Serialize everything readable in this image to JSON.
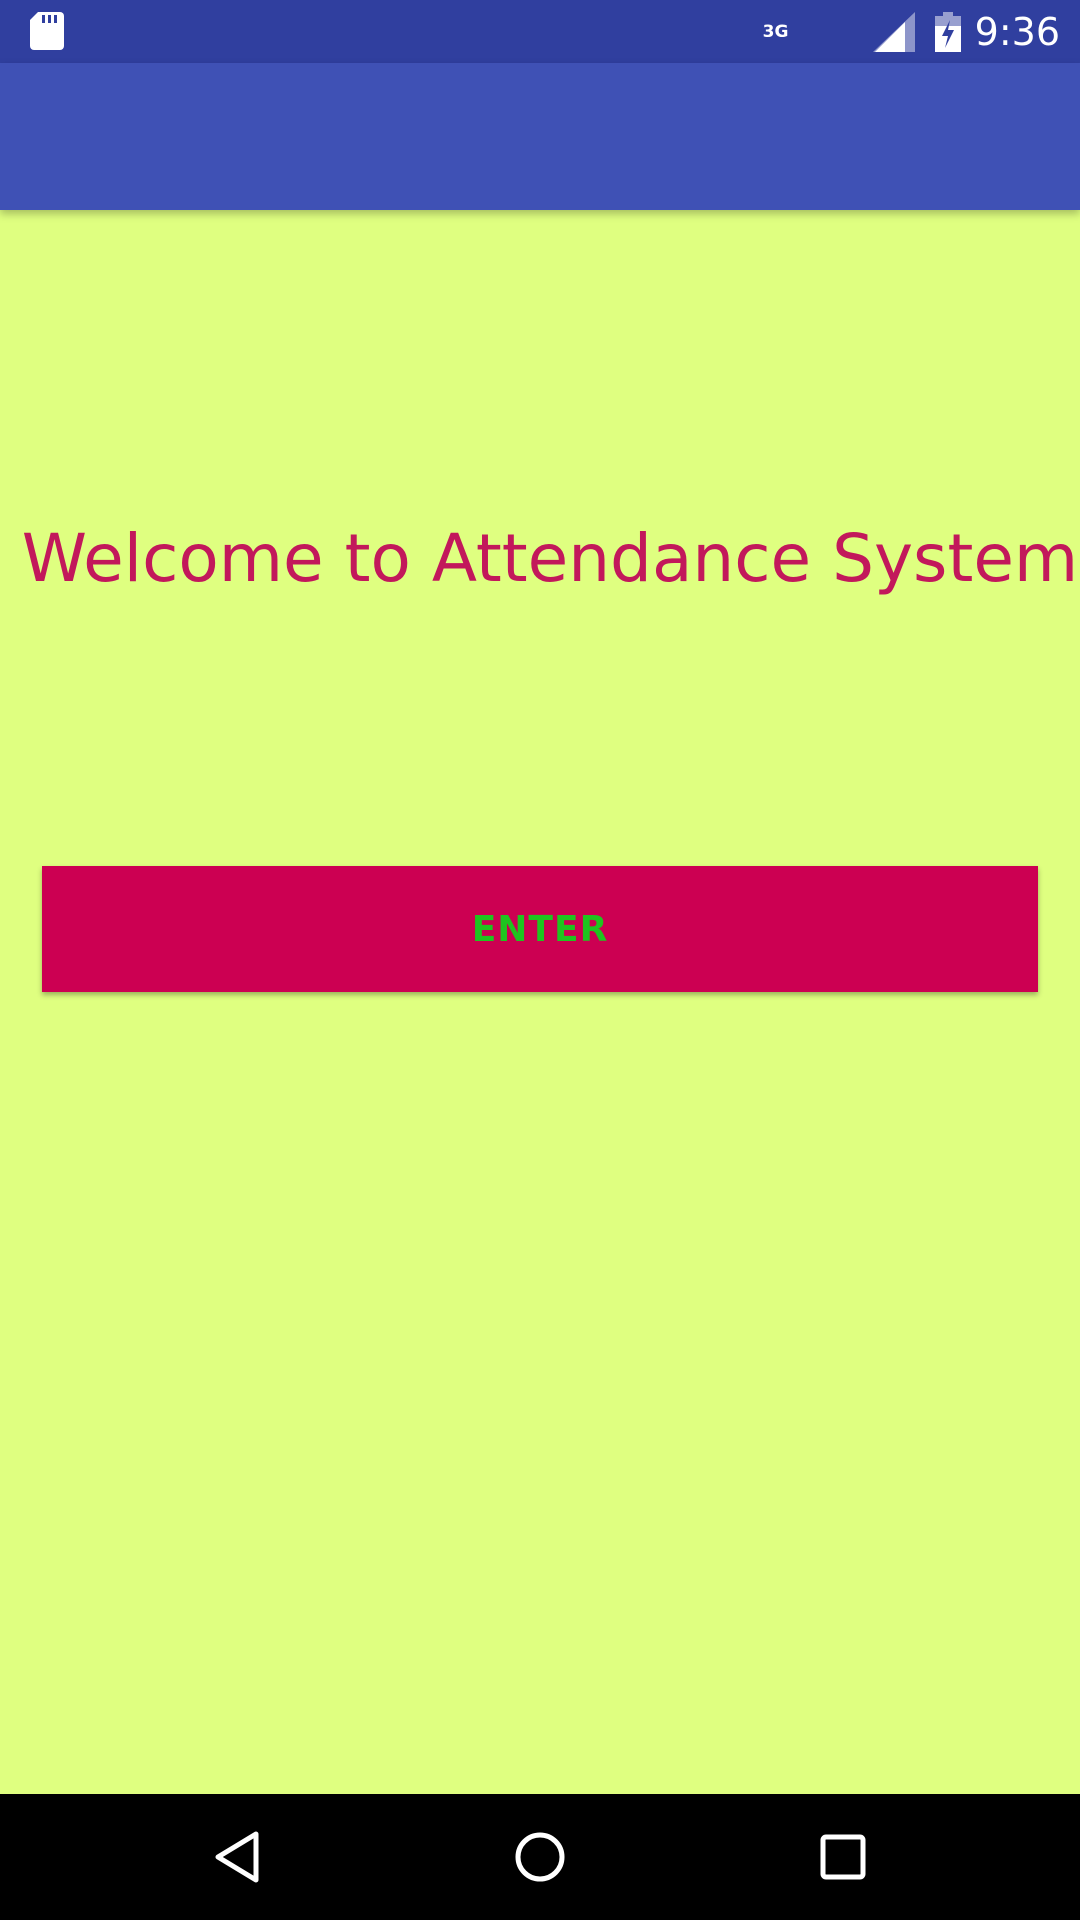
{
  "status_bar": {
    "network_type": "3G",
    "time": "9:36",
    "icons": [
      "sd-card-icon",
      "signal-icon",
      "battery-charging-icon"
    ]
  },
  "app_bar": {
    "title": ""
  },
  "main": {
    "welcome_text": "Welcome to Attendance System",
    "enter_button_label": "ENTER"
  },
  "nav_bar": {
    "icons": [
      "back-icon",
      "home-icon",
      "recents-icon"
    ]
  },
  "colors": {
    "background": "#DFFF80",
    "status_bar": "#303F9F",
    "app_bar": "#3F51B5",
    "welcome_text": "#C2185B",
    "button_bg": "#CC0052",
    "button_text": "#1FC41F"
  }
}
